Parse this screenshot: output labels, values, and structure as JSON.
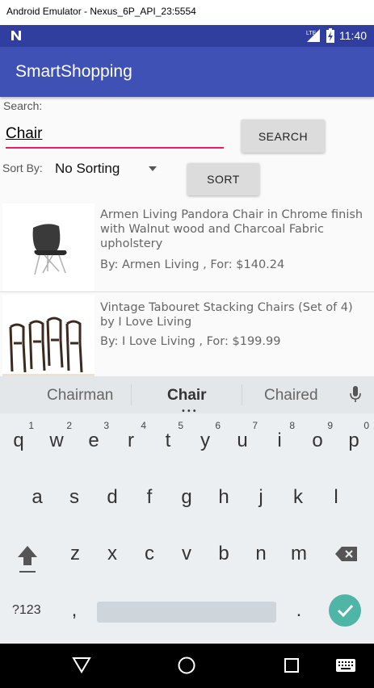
{
  "window": {
    "title": "Android Emulator - Nexus_6P_API_23:5554"
  },
  "status_bar": {
    "time": "11:40",
    "network": "LTE"
  },
  "app_bar": {
    "title": "SmartShopping"
  },
  "search": {
    "label": "Search:",
    "value": "Chair",
    "button": "SEARCH"
  },
  "sort": {
    "label": "Sort By:",
    "selected": "No Sorting",
    "button": "SORT"
  },
  "results": [
    {
      "desc": "Armen Living Pandora Chair in Chrome finish with Walnut wood and Charcoal Fabric upholstery",
      "meta": "By: Armen Living , For: $140.24"
    },
    {
      "desc": "Vintage Tabouret Stacking Chairs (Set of 4) by I Love Living",
      "meta": "By: I Love Living , For: $199.99"
    }
  ],
  "keyboard": {
    "suggestions": [
      "Chairman",
      "Chair",
      "Chaired"
    ],
    "row1": [
      "q",
      "w",
      "e",
      "r",
      "t",
      "y",
      "u",
      "i",
      "o",
      "p"
    ],
    "row1_hints": [
      "1",
      "2",
      "3",
      "4",
      "5",
      "6",
      "7",
      "8",
      "9",
      "0"
    ],
    "row2": [
      "a",
      "s",
      "d",
      "f",
      "g",
      "h",
      "j",
      "k",
      "l"
    ],
    "row3": [
      "z",
      "x",
      "c",
      "v",
      "b",
      "n",
      "m"
    ],
    "symbols_key": "?123",
    "comma": ",",
    "period": "."
  },
  "colors": {
    "primary": "#3f51b5",
    "primary_dark": "#303f9f",
    "accent": "#e91e63",
    "enter": "#4fb6a7"
  }
}
